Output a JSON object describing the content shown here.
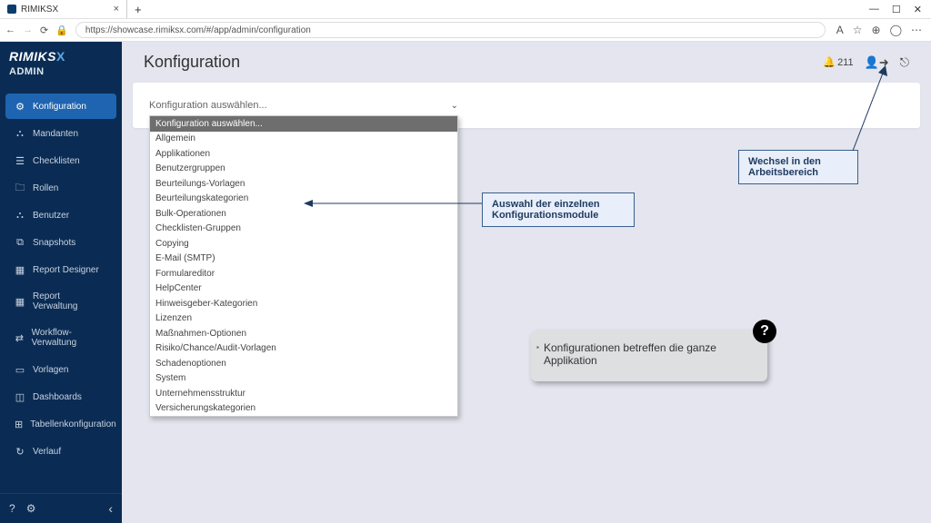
{
  "browser": {
    "tab_title": "RIMIKSX",
    "url": "https://showcase.rimiksx.com/#/app/admin/configuration",
    "window_controls": {
      "min": "—",
      "max": "☐",
      "close": "✕"
    }
  },
  "brand": {
    "logo_main": "RIMIKS",
    "logo_x": "X",
    "admin": "ADMIN"
  },
  "sidebar": {
    "items": [
      {
        "label": "Konfiguration",
        "icon": "⚙",
        "active": true
      },
      {
        "label": "Mandanten",
        "icon": "⛬"
      },
      {
        "label": "Checklisten",
        "icon": "☰"
      },
      {
        "label": "Rollen",
        "icon": "🗀"
      },
      {
        "label": "Benutzer",
        "icon": "⛬"
      },
      {
        "label": "Snapshots",
        "icon": "⧉"
      },
      {
        "label": "Report Designer",
        "icon": "▦"
      },
      {
        "label": "Report Verwaltung",
        "icon": "▦"
      },
      {
        "label": "Workflow-Verwaltung",
        "icon": "⇄"
      },
      {
        "label": "Vorlagen",
        "icon": "▭"
      },
      {
        "label": "Dashboards",
        "icon": "◫"
      },
      {
        "label": "Tabellenkonfiguration",
        "icon": "⊞"
      },
      {
        "label": "Verlauf",
        "icon": "↻"
      }
    ],
    "footer": {
      "help": "?",
      "gear": "⚙",
      "collapse": "‹"
    }
  },
  "page": {
    "title": "Konfiguration",
    "bell_count": "211",
    "select_label": "Konfiguration auswählen...",
    "options": [
      "Konfiguration auswählen...",
      "Allgemein",
      "Applikationen",
      "Benutzergruppen",
      "Beurteilungs-Vorlagen",
      "Beurteilungskategorien",
      "Bulk-Operationen",
      "Checklisten-Gruppen",
      "Copying",
      "E-Mail (SMTP)",
      "Formulareditor",
      "HelpCenter",
      "Hinweisgeber-Kategorien",
      "Lizenzen",
      "Maßnahmen-Optionen",
      "Risiko/Chance/Audit-Vorlagen",
      "Schadenoptionen",
      "System",
      "Unternehmensstruktur",
      "Versicherungskategorien"
    ]
  },
  "callouts": {
    "modules": "Auswahl der einzelnen Konfigurationsmodule",
    "workspace": "Wechsel in den Arbeitsbereich",
    "tip": "Konfigurationen betreffen die ganze Applikation"
  }
}
